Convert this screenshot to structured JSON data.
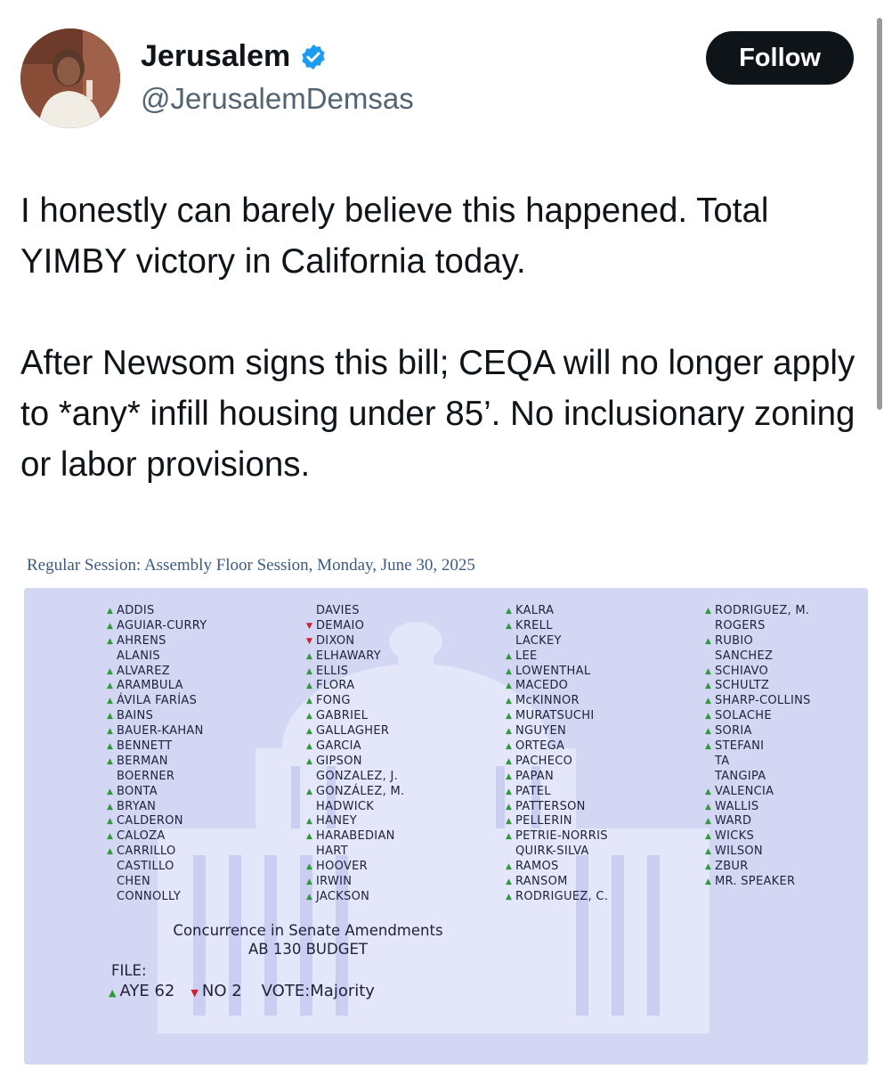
{
  "author": {
    "name": "Jerusalem",
    "handle": "@JerusalemDemsas",
    "verified": true,
    "avatar_icon": "profile-photo"
  },
  "follow_label": "Follow",
  "tweet": {
    "paragraph1": "I honestly can barely believe this happened. Total YIMBY victory in California today.",
    "paragraph2": "After Newsom signs this bill; CEQA will no longer apply to *any* infill housing under 85’. No inclusionary zoning or labor provisions."
  },
  "vote_record": {
    "session_title": "Regular Session: Assembly Floor Session, Monday, June 30, 2025",
    "columns": [
      [
        {
          "name": "ADDIS",
          "vote": "aye"
        },
        {
          "name": "AGUIAR-CURRY",
          "vote": "aye"
        },
        {
          "name": "AHRENS",
          "vote": "aye"
        },
        {
          "name": "ALANIS",
          "vote": ""
        },
        {
          "name": "ALVAREZ",
          "vote": "aye"
        },
        {
          "name": "ARAMBULA",
          "vote": "aye"
        },
        {
          "name": "ÁVILA FARÍAS",
          "vote": "aye"
        },
        {
          "name": "BAINS",
          "vote": "aye"
        },
        {
          "name": "BAUER-KAHAN",
          "vote": "aye"
        },
        {
          "name": "BENNETT",
          "vote": "aye"
        },
        {
          "name": "BERMAN",
          "vote": "aye"
        },
        {
          "name": "BOERNER",
          "vote": ""
        },
        {
          "name": "BONTA",
          "vote": "aye"
        },
        {
          "name": "BRYAN",
          "vote": "aye"
        },
        {
          "name": "CALDERON",
          "vote": "aye"
        },
        {
          "name": "CALOZA",
          "vote": "aye"
        },
        {
          "name": "CARRILLO",
          "vote": "aye"
        },
        {
          "name": "CASTILLO",
          "vote": ""
        },
        {
          "name": "CHEN",
          "vote": ""
        },
        {
          "name": "CONNOLLY",
          "vote": ""
        }
      ],
      [
        {
          "name": "DAVIES",
          "vote": ""
        },
        {
          "name": "DEMAIO",
          "vote": "no"
        },
        {
          "name": "DIXON",
          "vote": "no"
        },
        {
          "name": "ELHAWARY",
          "vote": "aye"
        },
        {
          "name": "ELLIS",
          "vote": "aye"
        },
        {
          "name": "FLORA",
          "vote": "aye"
        },
        {
          "name": "FONG",
          "vote": "aye"
        },
        {
          "name": "GABRIEL",
          "vote": "aye"
        },
        {
          "name": "GALLAGHER",
          "vote": "aye"
        },
        {
          "name": "GARCIA",
          "vote": "aye"
        },
        {
          "name": "GIPSON",
          "vote": "aye"
        },
        {
          "name": "GONZALEZ, J.",
          "vote": ""
        },
        {
          "name": "GONZÁLEZ, M.",
          "vote": "aye"
        },
        {
          "name": "HADWICK",
          "vote": ""
        },
        {
          "name": "HANEY",
          "vote": "aye"
        },
        {
          "name": "HARABEDIAN",
          "vote": "aye"
        },
        {
          "name": "HART",
          "vote": ""
        },
        {
          "name": "HOOVER",
          "vote": "aye"
        },
        {
          "name": "IRWIN",
          "vote": "aye"
        },
        {
          "name": "JACKSON",
          "vote": "aye"
        }
      ],
      [
        {
          "name": "KALRA",
          "vote": "aye"
        },
        {
          "name": "KRELL",
          "vote": "aye"
        },
        {
          "name": "LACKEY",
          "vote": ""
        },
        {
          "name": "LEE",
          "vote": "aye"
        },
        {
          "name": "LOWENTHAL",
          "vote": "aye"
        },
        {
          "name": "MACEDO",
          "vote": "aye"
        },
        {
          "name": "McKINNOR",
          "vote": "aye"
        },
        {
          "name": "MURATSUCHI",
          "vote": "aye"
        },
        {
          "name": "NGUYEN",
          "vote": "aye"
        },
        {
          "name": "ORTEGA",
          "vote": "aye"
        },
        {
          "name": "PACHECO",
          "vote": "aye"
        },
        {
          "name": "PAPAN",
          "vote": "aye"
        },
        {
          "name": "PATEL",
          "vote": "aye"
        },
        {
          "name": "PATTERSON",
          "vote": "aye"
        },
        {
          "name": "PELLERIN",
          "vote": "aye"
        },
        {
          "name": "PETRIE-NORRIS",
          "vote": "aye"
        },
        {
          "name": "QUIRK-SILVA",
          "vote": ""
        },
        {
          "name": "RAMOS",
          "vote": "aye"
        },
        {
          "name": "RANSOM",
          "vote": "aye"
        },
        {
          "name": "RODRIGUEZ, C.",
          "vote": "aye"
        }
      ],
      [
        {
          "name": "RODRIGUEZ, M.",
          "vote": "aye"
        },
        {
          "name": "ROGERS",
          "vote": ""
        },
        {
          "name": "RUBIO",
          "vote": "aye"
        },
        {
          "name": "SANCHEZ",
          "vote": ""
        },
        {
          "name": "SCHIAVO",
          "vote": "aye"
        },
        {
          "name": "SCHULTZ",
          "vote": "aye"
        },
        {
          "name": "SHARP-COLLINS",
          "vote": "aye"
        },
        {
          "name": "SOLACHE",
          "vote": "aye"
        },
        {
          "name": "SORIA",
          "vote": "aye"
        },
        {
          "name": "STEFANI",
          "vote": "aye"
        },
        {
          "name": "TA",
          "vote": ""
        },
        {
          "name": "TANGIPA",
          "vote": ""
        },
        {
          "name": "VALENCIA",
          "vote": "aye"
        },
        {
          "name": "WALLIS",
          "vote": "aye"
        },
        {
          "name": "WARD",
          "vote": "aye"
        },
        {
          "name": "WICKS",
          "vote": "aye"
        },
        {
          "name": "WILSON",
          "vote": "aye"
        },
        {
          "name": "ZBUR",
          "vote": "aye"
        },
        {
          "name": "MR. SPEAKER",
          "vote": "aye"
        }
      ]
    ],
    "motion_line1": "Concurrence in Senate Amendments",
    "motion_line2": "AB 130 BUDGET",
    "file_label": "FILE:",
    "aye_label": "AYE 62",
    "no_label": "NO 2",
    "vote_label": "VOTE:Majority"
  },
  "colors": {
    "aye": "#2f9a3c",
    "no": "#d11e2a",
    "panel": "#d3d7f4",
    "verified": "#1d9bf0"
  }
}
